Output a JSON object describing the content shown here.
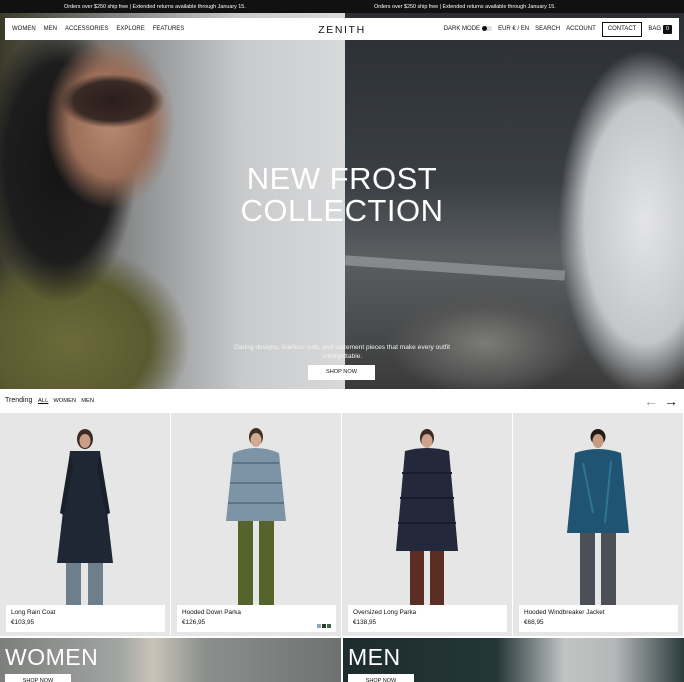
{
  "announcement": {
    "text_1": "Orders over $250 ship free | Extended returns available through January 15.",
    "text_2": "Orders over $250 ship free | Extended returns available through January 15."
  },
  "nav": {
    "left_links": [
      "WOMEN",
      "MEN",
      "ACCESSORIES",
      "EXPLORE",
      "FEATURES"
    ],
    "logo": "ZENITH",
    "dark_mode": "DARK MODE",
    "currency_lang": "EUR € / EN",
    "search": "SEARCH",
    "account": "ACCOUNT",
    "contact": "CONTACT",
    "bag": "BAG",
    "bag_count": "0"
  },
  "hero": {
    "title_line1": "NEW FROST",
    "title_line2": "COLLECTION",
    "subtitle": "Daring designs, fearless cuts, and statement pieces that make every outfit unforgettable.",
    "button": "SHOP NOW"
  },
  "trending": {
    "title": "Trending",
    "tabs": [
      "ALL",
      "WOMEN",
      "MEN"
    ],
    "active_tab": "ALL",
    "prev_icon": "arrow-left-icon",
    "next_icon": "arrow-right-icon"
  },
  "products": [
    {
      "name": "Long Rain Coat",
      "price": "€103,95"
    },
    {
      "name": "Hooded Down Parka",
      "price": "€126,95",
      "swatches": [
        "#8fa8b8",
        "#2d3a2a",
        "#3b6b3e"
      ]
    },
    {
      "name": "Oversized Long Parka",
      "price": "€138,95"
    },
    {
      "name": "Hooded Windbreaker Jacket",
      "price": "€68,95"
    }
  ],
  "categories": [
    {
      "title": "WOMEN",
      "button": "SHOP NOW"
    },
    {
      "title": "MEN",
      "button": "SHOP NOW"
    }
  ]
}
